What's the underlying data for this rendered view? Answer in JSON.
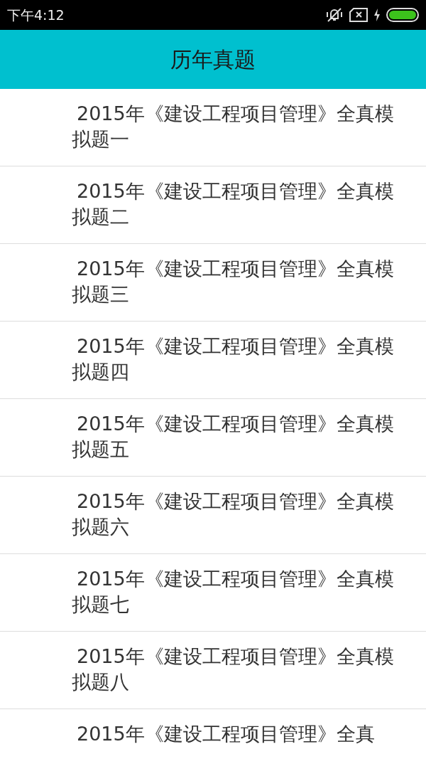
{
  "status_bar": {
    "time": "下午4:12"
  },
  "header": {
    "title": "历年真题"
  },
  "items": [
    {
      "text": "2015年《建设工程项目管理》全真模拟题一"
    },
    {
      "text": "2015年《建设工程项目管理》全真模拟题二"
    },
    {
      "text": "2015年《建设工程项目管理》全真模拟题三"
    },
    {
      "text": "2015年《建设工程项目管理》全真模拟题四"
    },
    {
      "text": "2015年《建设工程项目管理》全真模拟题五"
    },
    {
      "text": "2015年《建设工程项目管理》全真模拟题六"
    },
    {
      "text": "2015年《建设工程项目管理》全真模拟题七"
    },
    {
      "text": "2015年《建设工程项目管理》全真模拟题八"
    },
    {
      "text": "2015年《建设工程项目管理》全真"
    }
  ]
}
